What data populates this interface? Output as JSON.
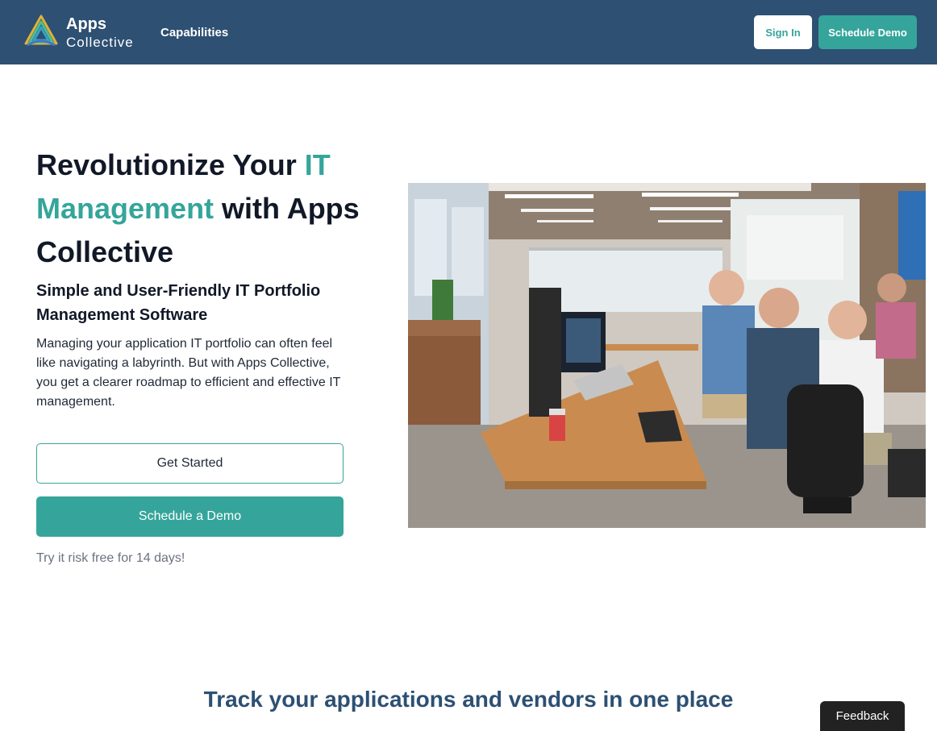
{
  "header": {
    "brand_line1": "Apps",
    "brand_line2": "Collective",
    "nav_capabilities": "Capabilities",
    "sign_in_label": "Sign In",
    "schedule_demo_label": "Schedule Demo"
  },
  "hero": {
    "title_part1": "Revolutionize Your ",
    "title_accent": "IT Management",
    "title_part2": " with Apps Collective",
    "subtitle": "Simple and User-Friendly IT Portfolio Management Software",
    "description": "Managing your application IT portfolio can often feel like navigating a labyrinth. But with Apps Collective, you get a clearer roadmap to efficient and effective IT management.",
    "get_started_label": "Get Started",
    "schedule_demo_label": "Schedule a Demo",
    "trial_note": "Try it risk free for 14 days!"
  },
  "section": {
    "title": "Track your applications and vendors in one place"
  },
  "feedback": {
    "label": "Feedback"
  },
  "colors": {
    "header_bg": "#2d5073",
    "accent": "#35a59b",
    "dark_text": "#111827",
    "feedback_bg": "#222222"
  },
  "icons": {
    "logo": "apps-collective-logo-icon"
  }
}
